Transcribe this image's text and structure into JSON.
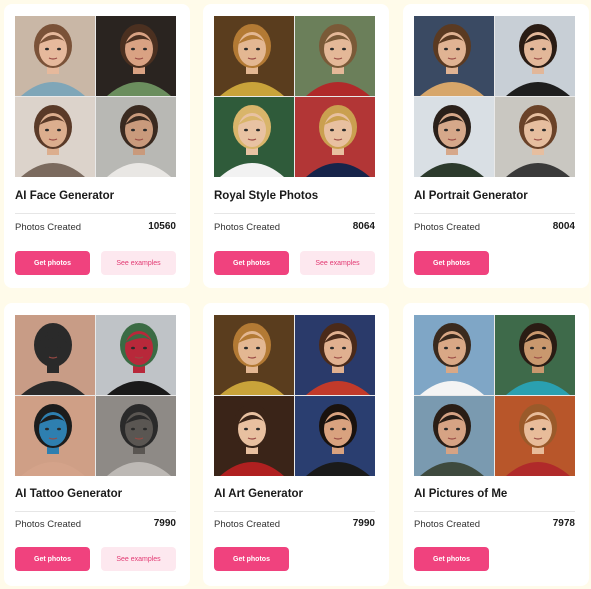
{
  "cards": [
    {
      "title": "AI Face Generator",
      "stat_label": "Photos Created",
      "count": "10560",
      "primary_label": "Get photos",
      "secondary_label": "See examples",
      "has_secondary": true,
      "tiles": [
        {
          "bg": "#c9b7a6",
          "skin": "#e6b99c",
          "hair": "#7a5238",
          "accent": "#7fa6b8"
        },
        {
          "bg": "#2a2420",
          "skin": "#d9a283",
          "hair": "#4b3020",
          "accent": "#6b8e5e"
        },
        {
          "bg": "#dcd3cb",
          "skin": "#dcae8e",
          "hair": "#5a3a28",
          "accent": "#7b6a5e"
        },
        {
          "bg": "#b8b8b4",
          "skin": "#c99a7c",
          "hair": "#3a2a20",
          "accent": "#e9e7e4"
        }
      ]
    },
    {
      "title": "Royal Style Photos",
      "stat_label": "Photos Created",
      "count": "8064",
      "primary_label": "Get photos",
      "secondary_label": "See examples",
      "has_secondary": true,
      "tiles": [
        {
          "bg": "#5a3d1e",
          "skin": "#e3b792",
          "hair": "#b37a34",
          "accent": "#c9a33a"
        },
        {
          "bg": "#6b7f5a",
          "skin": "#e4b898",
          "hair": "#7a5a38",
          "accent": "#b02a2a"
        },
        {
          "bg": "#2f5b3a",
          "skin": "#e8c2a2",
          "hair": "#d9b56a",
          "accent": "#f2f2f2"
        },
        {
          "bg": "#b23636",
          "skin": "#e8c0a0",
          "hair": "#caa050",
          "accent": "#16244a"
        }
      ]
    },
    {
      "title": "AI Portrait Generator",
      "stat_label": "Photos Created",
      "count": "8004",
      "primary_label": "Get photos",
      "secondary_label": "",
      "has_secondary": false,
      "tiles": [
        {
          "bg": "#3a4a63",
          "skin": "#e0b393",
          "hair": "#5a3a22",
          "accent": "#d7a66a"
        },
        {
          "bg": "#c8cfd6",
          "skin": "#e2b799",
          "hair": "#2a1c14",
          "accent": "#1e1e1e"
        },
        {
          "bg": "#d9dfe4",
          "skin": "#d6a88a",
          "hair": "#2a201a",
          "accent": "#2c3a2c"
        },
        {
          "bg": "#c9c7c1",
          "skin": "#e6be9f",
          "hair": "#6a4228",
          "accent": "#3a3a3a"
        }
      ]
    },
    {
      "title": "AI Tattoo Generator",
      "stat_label": "Photos Created",
      "count": "7990",
      "primary_label": "Get photos",
      "secondary_label": "See examples",
      "has_secondary": true,
      "tiles": [
        {
          "bg": "#c89c86",
          "skin": "#2a2a2a",
          "hair": "#2a2a2a",
          "accent": "#2a2a2a"
        },
        {
          "bg": "#bfc3c7",
          "skin": "#b8283a",
          "hair": "#3b6b44",
          "accent": "#1a1a1a"
        },
        {
          "bg": "#cf9f86",
          "skin": "#2e7fb0",
          "hair": "#1c1c1c",
          "accent": "#d4a38a"
        },
        {
          "bg": "#8e8a86",
          "skin": "#5a5652",
          "hair": "#2a2a2a",
          "accent": "#bdb9b5"
        }
      ]
    },
    {
      "title": "AI Art Generator",
      "stat_label": "Photos Created",
      "count": "7990",
      "primary_label": "Get photos",
      "secondary_label": "",
      "has_secondary": false,
      "tiles": [
        {
          "bg": "#5a3d1e",
          "skin": "#e3b792",
          "hair": "#b37a34",
          "accent": "#c9a33a"
        },
        {
          "bg": "#2a3a6a",
          "skin": "#e0b090",
          "hair": "#4a2a1a",
          "accent": "#c23a2a"
        },
        {
          "bg": "#3a2418",
          "skin": "#e8c0a0",
          "hair": "#3a2418",
          "accent": "#b02020"
        },
        {
          "bg": "#2a3e70",
          "skin": "#d9a27f",
          "hair": "#1a120e",
          "accent": "#1a1a1a"
        }
      ]
    },
    {
      "title": "AI Pictures of Me",
      "stat_label": "Photos Created",
      "count": "7978",
      "primary_label": "Get photos",
      "secondary_label": "",
      "has_secondary": false,
      "tiles": [
        {
          "bg": "#7fa6c6",
          "skin": "#d9a886",
          "hair": "#3a2a1e",
          "accent": "#f4f4f4"
        },
        {
          "bg": "#3e6a4a",
          "skin": "#c9986e",
          "hair": "#2a1c14",
          "accent": "#2aa0b0"
        },
        {
          "bg": "#7a9ab0",
          "skin": "#d6a384",
          "hair": "#2a1e16",
          "accent": "#3e4a3e"
        },
        {
          "bg": "#b8562a",
          "skin": "#e8bc9a",
          "hair": "#9a5a2a",
          "accent": "#b02a2a"
        }
      ]
    }
  ]
}
